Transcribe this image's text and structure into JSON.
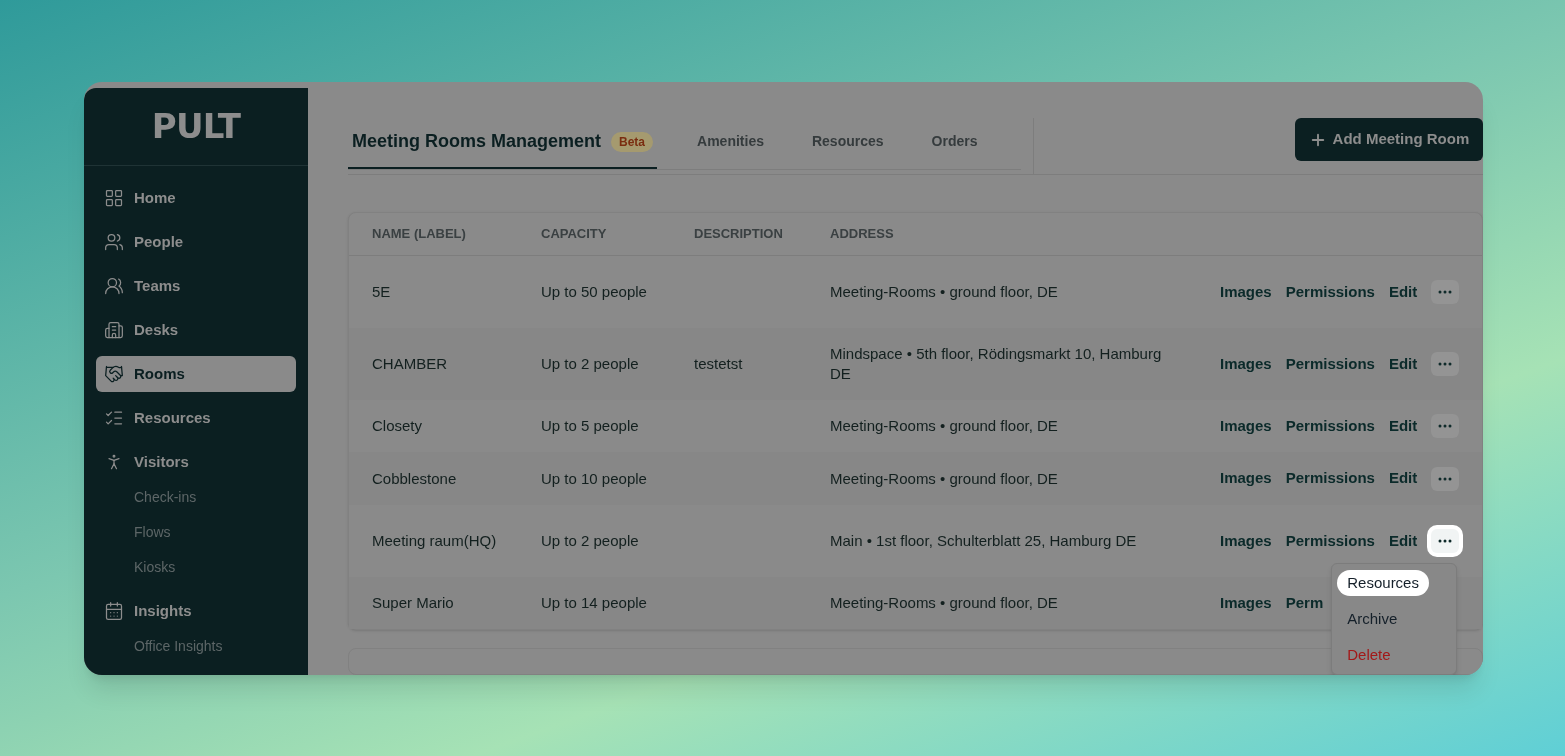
{
  "sidebar": {
    "logo": "PULT",
    "items": [
      {
        "label": "Home",
        "selected": false
      },
      {
        "label": "People",
        "selected": false
      },
      {
        "label": "Teams",
        "selected": false
      },
      {
        "label": "Desks",
        "selected": false
      },
      {
        "label": "Rooms",
        "selected": true
      },
      {
        "label": "Resources",
        "selected": false
      },
      {
        "label": "Visitors",
        "selected": false,
        "children": [
          {
            "label": "Check-ins"
          },
          {
            "label": "Flows"
          },
          {
            "label": "Kiosks"
          }
        ]
      },
      {
        "label": "Insights",
        "selected": false,
        "children": [
          {
            "label": "Office Insights"
          }
        ]
      }
    ]
  },
  "tabs": [
    {
      "label": "Meeting Rooms Management",
      "badge": "Beta",
      "selected": true
    },
    {
      "label": "Amenities",
      "selected": false
    },
    {
      "label": "Resources",
      "selected": false
    },
    {
      "label": "Orders",
      "selected": false
    }
  ],
  "add_button": "Add Meeting Room",
  "table": {
    "columns": [
      "NAME (LABEL)",
      "CAPACITY",
      "DESCRIPTION",
      "ADDRESS"
    ],
    "rows": [
      {
        "name": "5E",
        "capacity": "Up to 50 people",
        "address": "Meeting-Rooms • ground floor, DE",
        "actions": [
          "Images",
          "Permissions",
          "Edit"
        ],
        "menu_open": false
      },
      {
        "name": "CHAMBER",
        "capacity": "Up to 2 people",
        "description": "testetst",
        "address": "Mindspace • 5th floor, Rödingsmarkt 10, Hamburg DE",
        "actions": [
          "Images",
          "Permissions",
          "Edit"
        ],
        "menu_open": false
      },
      {
        "name": "Closety",
        "capacity": "Up to 5 people",
        "address": "Meeting-Rooms • ground floor, DE",
        "actions": [
          "Images",
          "Permissions",
          "Edit"
        ],
        "menu_open": false
      },
      {
        "name": "Cobblestone",
        "capacity": "Up to 10 people",
        "address": "Meeting-Rooms • ground floor, DE",
        "actions": [
          "Images",
          "Permissions",
          "Edit"
        ],
        "menu_open": false
      },
      {
        "name": "Meeting raum(HQ)",
        "capacity": "Up to 2 people",
        "address": "Main • 1st floor, Schulterblatt 25, Hamburg DE",
        "actions": [
          "Images",
          "Permissions",
          "Edit"
        ],
        "menu_open": true
      },
      {
        "name": "Super Mario",
        "capacity": "Up to 14 people",
        "address": "Meeting-Rooms • ground floor, DE",
        "actions": [
          "Images",
          "Perm"
        ]
      }
    ]
  },
  "menu": {
    "items": [
      {
        "label": "Resources",
        "kind": "normal",
        "selected": true
      },
      {
        "label": "Archive",
        "kind": "normal",
        "selected": false
      },
      {
        "label": "Delete",
        "kind": "danger",
        "selected": false
      }
    ]
  }
}
